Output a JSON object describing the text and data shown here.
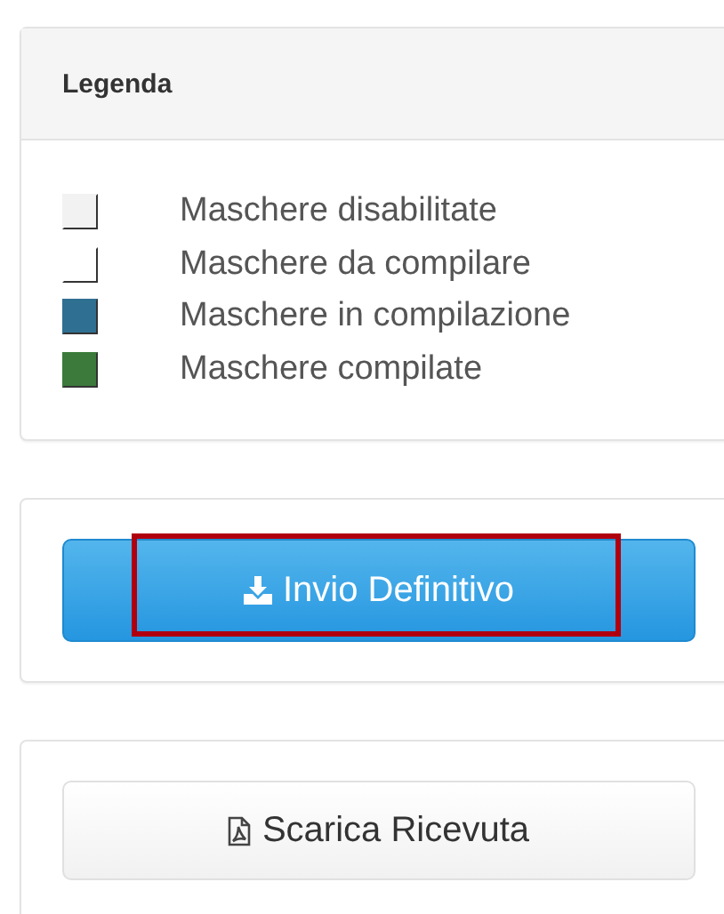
{
  "legend": {
    "title": "Legenda",
    "items": [
      {
        "label": "Maschere disabilitate",
        "color": "#f2f2f2"
      },
      {
        "label": "Maschere da compilare",
        "color": "#ffffff"
      },
      {
        "label": "Maschere in compilazione",
        "color": "#2f6f91"
      },
      {
        "label": "Maschere compilate",
        "color": "#3b7a3b"
      }
    ]
  },
  "actions": [
    {
      "kind": "primary",
      "label": "Invio Definitivo",
      "highlighted": true
    },
    {
      "kind": "default",
      "label": "Scarica Ricevuta",
      "highlighted": false
    }
  ]
}
